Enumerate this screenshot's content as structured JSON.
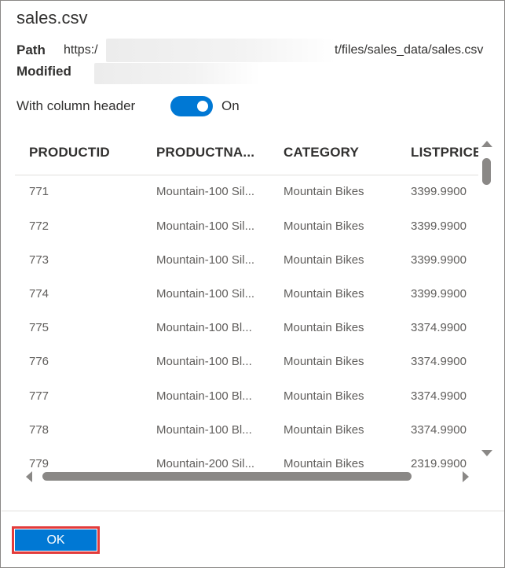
{
  "dialog": {
    "title": "sales.csv",
    "path_label": "Path",
    "path_prefix": "https:/",
    "path_suffix": "t/files/sales_data/sales.csv",
    "modified_label": "Modified",
    "modified_value": ""
  },
  "toggle": {
    "label": "With column header",
    "state_text": "On",
    "checked": true
  },
  "table": {
    "columns": [
      "PRODUCTID",
      "PRODUCTNA...",
      "CATEGORY",
      "LISTPRICE"
    ],
    "rows": [
      [
        "771",
        "Mountain-100 Sil...",
        "Mountain Bikes",
        "3399.9900"
      ],
      [
        "772",
        "Mountain-100 Sil...",
        "Mountain Bikes",
        "3399.9900"
      ],
      [
        "773",
        "Mountain-100 Sil...",
        "Mountain Bikes",
        "3399.9900"
      ],
      [
        "774",
        "Mountain-100 Sil...",
        "Mountain Bikes",
        "3399.9900"
      ],
      [
        "775",
        "Mountain-100 Bl...",
        "Mountain Bikes",
        "3374.9900"
      ],
      [
        "776",
        "Mountain-100 Bl...",
        "Mountain Bikes",
        "3374.9900"
      ],
      [
        "777",
        "Mountain-100 Bl...",
        "Mountain Bikes",
        "3374.9900"
      ],
      [
        "778",
        "Mountain-100 Bl...",
        "Mountain Bikes",
        "3374.9900"
      ],
      [
        "779",
        "Mountain-200 Sil...",
        "Mountain Bikes",
        "2319.9900"
      ]
    ]
  },
  "footer": {
    "ok_label": "OK"
  },
  "colors": {
    "accent": "#0078d4",
    "highlight_outline": "#e23b3b"
  }
}
